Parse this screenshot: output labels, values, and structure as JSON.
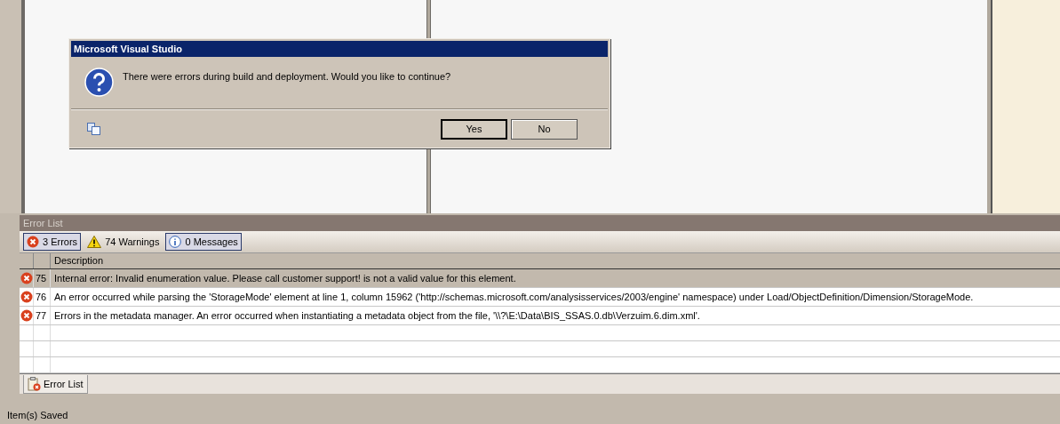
{
  "dialog": {
    "title": "Microsoft Visual Studio",
    "message": "There were errors during build and deployment. Would you like to continue?",
    "buttons": [
      {
        "label": "Yes",
        "default": true
      },
      {
        "label": "No",
        "default": false
      }
    ]
  },
  "error_list": {
    "title": "Error List",
    "filters": [
      {
        "kind": "error",
        "label": "3 Errors",
        "selected": true
      },
      {
        "kind": "warning",
        "label": "74 Warnings",
        "selected": false
      },
      {
        "kind": "message",
        "label": "0 Messages",
        "selected": true
      }
    ],
    "columns": [
      "Description"
    ],
    "rows": [
      {
        "kind": "error",
        "number": "75",
        "description": "Internal error: Invalid enumeration value. Please call customer support! is not a valid value for this element.",
        "selected": true
      },
      {
        "kind": "error",
        "number": "76",
        "description": "An error occurred while parsing the 'StorageMode' element at line 1, column 15962 ('http://schemas.microsoft.com/analysisservices/2003/engine' namespace) under Load/ObjectDefinition/Dimension/StorageMode.",
        "selected": false
      },
      {
        "kind": "error",
        "number": "77",
        "description": "Errors in the metadata manager. An error occurred when instantiating a metadata object from the file, '\\\\?\\E:\\Data\\BIS_SSAS.0.db\\Verzuim.6.dim.xml'.",
        "selected": false
      }
    ]
  },
  "tabs": [
    {
      "label": "Error List",
      "selected": true
    }
  ],
  "status_bar": "Item(s) Saved"
}
